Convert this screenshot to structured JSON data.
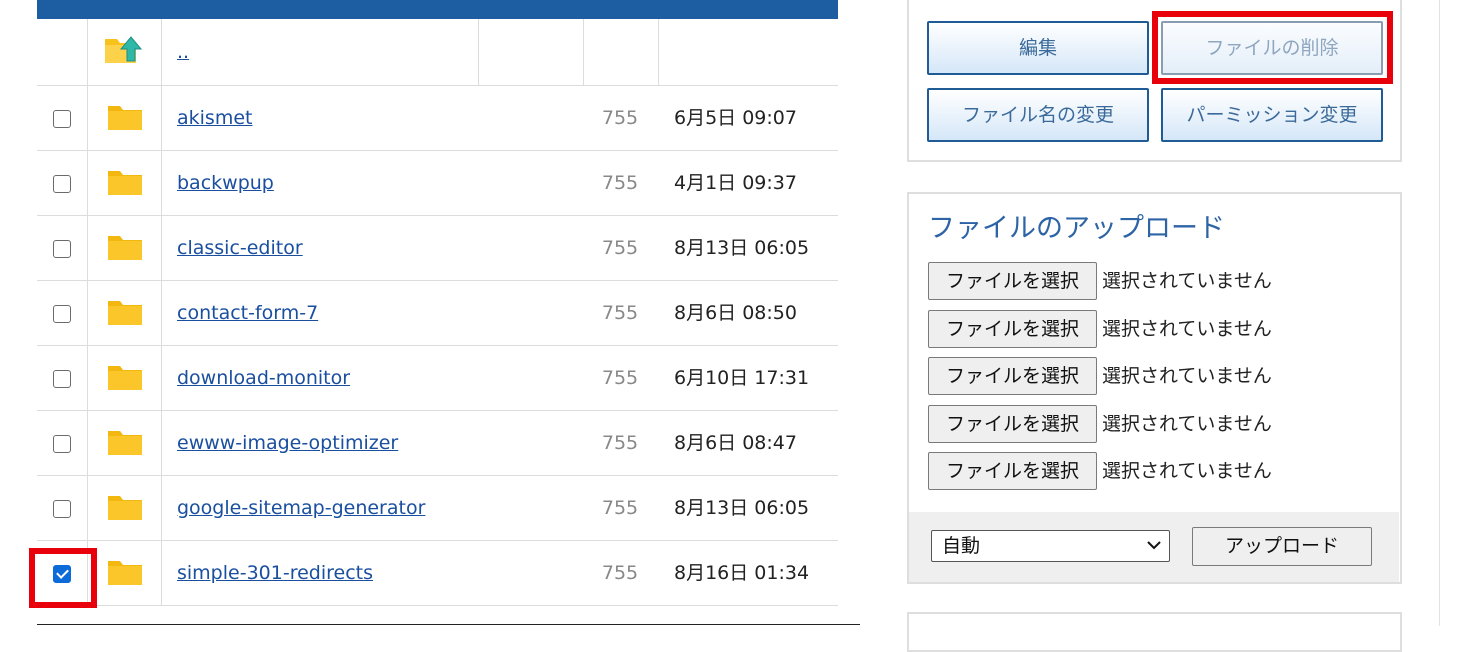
{
  "file_table": {
    "parent_row": {
      "name": ".."
    },
    "rows": [
      {
        "name": "akismet",
        "permission": "755",
        "modified": "6月5日 09:07",
        "checked": false
      },
      {
        "name": "backwpup",
        "permission": "755",
        "modified": "4月1日 09:37",
        "checked": false
      },
      {
        "name": "classic-editor",
        "permission": "755",
        "modified": "8月13日 06:05",
        "checked": false
      },
      {
        "name": "contact-form-7",
        "permission": "755",
        "modified": "8月6日 08:50",
        "checked": false
      },
      {
        "name": "download-monitor",
        "permission": "755",
        "modified": "6月10日 17:31",
        "checked": false
      },
      {
        "name": "ewww-image-optimizer",
        "permission": "755",
        "modified": "8月6日 08:47",
        "checked": false
      },
      {
        "name": "google-sitemap-generator",
        "permission": "755",
        "modified": "8月13日 06:05",
        "checked": false
      },
      {
        "name": "simple-301-redirects",
        "permission": "755",
        "modified": "8月16日 01:34",
        "checked": true
      }
    ]
  },
  "actions": {
    "edit": "編集",
    "delete": "ファイルの削除",
    "rename": "ファイル名の変更",
    "permission": "パーミッション変更"
  },
  "upload": {
    "title": "ファイルのアップロード",
    "choose_label": "ファイルを選択",
    "no_file_text": "選択されていません",
    "slots": 5,
    "encoding_selected": "自動",
    "upload_button": "アップロード"
  },
  "colors": {
    "header_bar": "#1d5ea3",
    "link": "#1a4fa0",
    "highlight": "#e8000b",
    "folder": "#f7c21b"
  },
  "icons": [
    "folder-icon",
    "folder-up-icon",
    "chevron-down-icon"
  ]
}
